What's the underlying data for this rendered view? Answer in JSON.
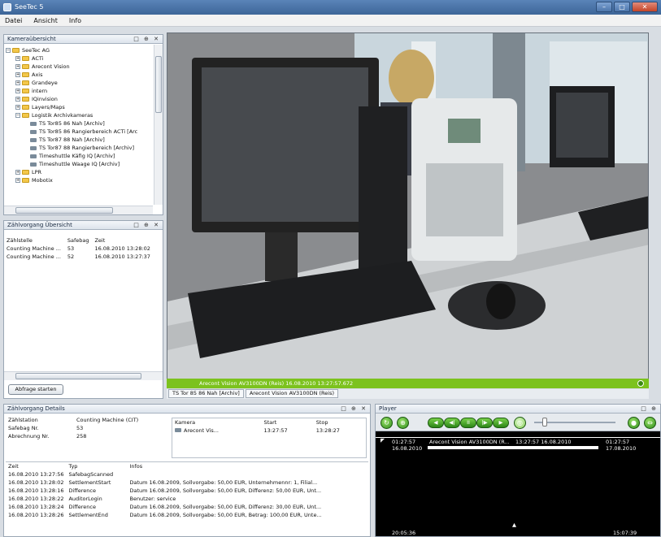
{
  "window": {
    "title": "SeeTec 5"
  },
  "menu": [
    "Datei",
    "Ansicht",
    "Info"
  ],
  "camera_panel": {
    "title": "Kameraübersicht",
    "root": "SeeTec AG",
    "folders": [
      "ACTi",
      "Arecont Vision",
      "Axis",
      "Grandeye",
      "intern",
      "IQinvision",
      "Layers/Maps",
      "Logistik Archivkameras"
    ],
    "cameras": [
      "TS Tor85 86 Nah [Archiv]",
      "TS Tor85 86 Rangierbereich ACTi [Arc",
      "TS Tor87 88 Nah [Archiv]",
      "TS Tor87 88 Rangierbereich [Archiv]",
      "Timeshuttle Käfig IQ [Archiv]",
      "Timeshuttle Waage IQ [Archiv]"
    ],
    "folders_after": [
      "LPR",
      "Mobotix"
    ]
  },
  "overview_panel": {
    "title": "Zählvorgang Übersicht",
    "columns": [
      "Zählstelle",
      "Safebag",
      "Zeit"
    ],
    "rows": [
      [
        "Counting Machine ...",
        "53",
        "16.08.2010 13:28:02"
      ],
      [
        "Counting Machine ...",
        "52",
        "16.08.2010 13:27:37"
      ]
    ],
    "button": "Abfrage starten"
  },
  "video": {
    "status": "Arecont Vision AV3100DN (Reis) 16.08.2010 13:27:57.672",
    "tabs": [
      "TS Tor 85 86 Nah [Archiv]",
      "Arecont Vision AV3100DN (Reis)"
    ]
  },
  "details_panel": {
    "title": "Zählvorgang Details",
    "fields": [
      {
        "label": "Zählstation",
        "value": "Counting Machine (CIT)"
      },
      {
        "label": "Safebag Nr.",
        "value": "53"
      },
      {
        "label": "Abrechnung Nr.",
        "value": "258"
      }
    ],
    "cam_columns": [
      "Kamera",
      "Start",
      "Stop"
    ],
    "cam_rows": [
      [
        "Arecont Vis...",
        "13:27:57",
        "13:28:27"
      ]
    ],
    "log_columns": [
      "Zeit",
      "Typ",
      "Infos"
    ],
    "log_rows": [
      [
        "16.08.2010 13:27:56",
        "SafebagScanned",
        ""
      ],
      [
        "16.08.2010 13:28:02",
        "SettlementStart",
        "Datum 16.08.2009, Sollvorgabe: 50,00 EUR, Unternehmennr: 1, Filial..."
      ],
      [
        "16.08.2010 13:28:16",
        "Difference",
        "Datum 16.08.2009, Sollvorgabe: 50,00 EUR, Differenz: 50,00 EUR, Unt..."
      ],
      [
        "16.08.2010 13:28:22",
        "AuditorLogin",
        "Benutzer: service"
      ],
      [
        "16.08.2010 13:28:24",
        "Difference",
        "Datum 16.08.2009, Sollvorgabe: 50,00 EUR, Differenz: 30,00 EUR, Unt..."
      ],
      [
        "16.08.2010 13:28:26",
        "SettlementEnd",
        "Datum 16.08.2009, Sollvorgabe: 50,00 EUR, Betrag: 100,00 EUR, Unte..."
      ]
    ]
  },
  "player": {
    "title": "Player",
    "clip_start_time": "01:27:57",
    "clip_start_date": "16.08.2010",
    "clip_label": "Arecont Vision AV3100DN (R...",
    "clip_marker": "13:27:57  16.08.2010",
    "clip_end_time": "01:27:57",
    "clip_end_date": "17.08.2010",
    "time_left": "20:05:36",
    "time_right": "15:07:39"
  },
  "colors": {
    "accent_green": "#7cc21e",
    "titlebar": "#3d6598"
  }
}
